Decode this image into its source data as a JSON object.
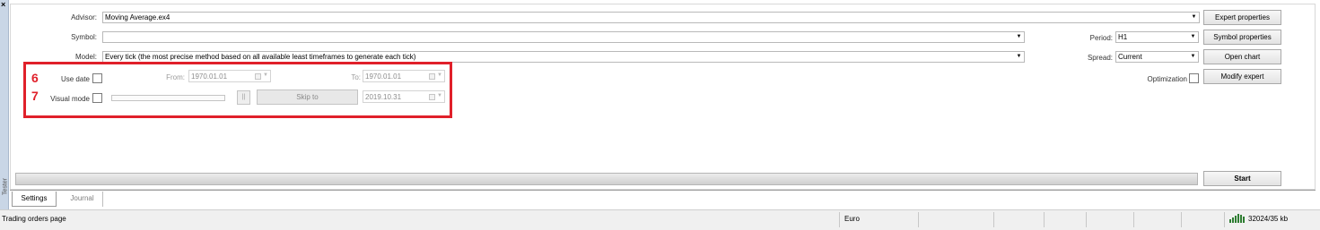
{
  "window": {
    "close_glyph": "×",
    "side_label": "Tester"
  },
  "form": {
    "advisor": {
      "label": "Advisor:",
      "value": "Moving Average.ex4"
    },
    "symbol": {
      "label": "Symbol:",
      "value": ""
    },
    "model": {
      "label": "Model:",
      "value": "Every tick (the most precise method based on all available least timeframes to generate each tick)"
    },
    "period": {
      "label": "Period:",
      "value": "H1"
    },
    "spread": {
      "label": "Spread:",
      "value": "Current"
    },
    "use_date": {
      "label": "Use date",
      "checked": false
    },
    "from": {
      "label": "From:",
      "value": "1970.01.01"
    },
    "to": {
      "label": "To:",
      "value": "1970.01.01"
    },
    "visual_mode": {
      "label": "Visual mode",
      "checked": false
    },
    "pause_label": "||",
    "skip_to_label": "Skip to",
    "skip_date": "2019.10.31",
    "optimization": {
      "label": "Optimization",
      "checked": false
    }
  },
  "buttons": {
    "expert_properties": "Expert properties",
    "symbol_properties": "Symbol properties",
    "open_chart": "Open chart",
    "modify_expert": "Modify expert",
    "start": "Start"
  },
  "annotations": {
    "n6": "6",
    "n7": "7",
    "color": "#e0202a"
  },
  "progress": {
    "fraction": 0.0
  },
  "tabs": [
    {
      "label": "Settings",
      "active": true
    },
    {
      "label": "Journal",
      "active": false
    }
  ],
  "status": {
    "message": "Trading orders page",
    "currency": "Euro",
    "traffic": "32024/35 kb",
    "icon": "connection-bars-icon"
  }
}
